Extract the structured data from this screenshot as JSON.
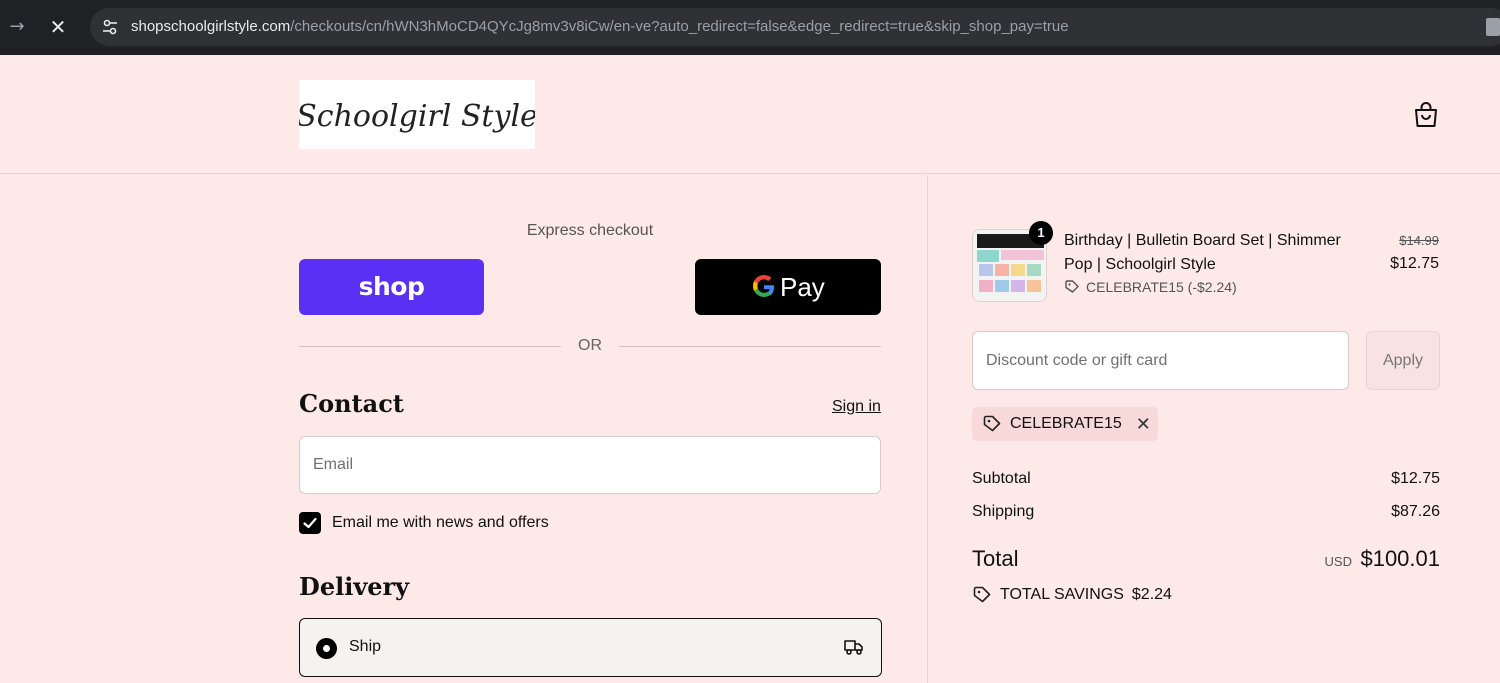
{
  "browser": {
    "url_domain": "shopschoolgirlstyle.com",
    "url_path": "/checkouts/cn/hWN3hMoCD4QYcJg8mv3v8iCw/en-ve?auto_redirect=false&edge_redirect=true&skip_shop_pay=true"
  },
  "header": {
    "logo_text": "Schoolgirl Style"
  },
  "express": {
    "label": "Express checkout",
    "shop_label": "shop",
    "gpay_label": "Pay",
    "or_label": "OR"
  },
  "contact": {
    "title": "Contact",
    "signin_label": "Sign in",
    "email_placeholder": "Email",
    "newsletter_label": "Email me with news and offers",
    "newsletter_checked": true
  },
  "delivery": {
    "title": "Delivery",
    "option_label": "Ship"
  },
  "order": {
    "product_name": "Birthday | Bulletin Board Set | Shimmer Pop | Schoolgirl Style",
    "quantity": "1",
    "price_original": "$14.99",
    "price_now": "$12.75",
    "discount_line": "CELEBRATE15 (-$2.24)",
    "discount_placeholder": "Discount code or gift card",
    "apply_label": "Apply",
    "applied_code": "CELEBRATE15",
    "subtotal_label": "Subtotal",
    "subtotal_value": "$12.75",
    "shipping_label": "Shipping",
    "shipping_value": "$87.26",
    "total_label": "Total",
    "total_currency": "USD",
    "total_value": "$100.01",
    "savings_label": "TOTAL SAVINGS",
    "savings_value": "$2.24"
  },
  "colors": {
    "page_bg": "#fde9e8",
    "shop_pay": "#5a31f4",
    "gpay": "#000000",
    "chip_bg": "#f6d9d8"
  }
}
